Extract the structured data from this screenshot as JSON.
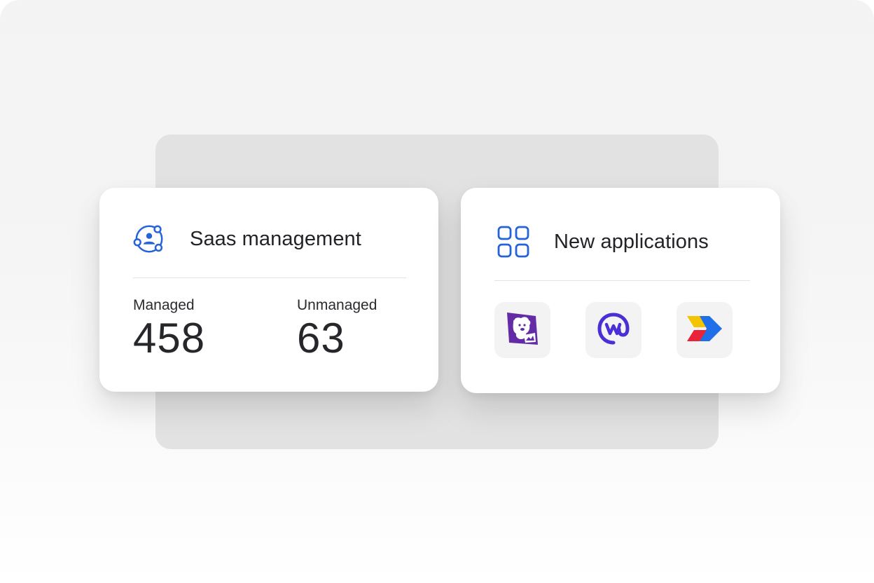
{
  "saas_card": {
    "title": "Saas management",
    "icon": "user-network-icon",
    "stats": [
      {
        "label": "Managed",
        "value": "458"
      },
      {
        "label": "Unmanaged",
        "value": "63"
      }
    ]
  },
  "apps_card": {
    "title": "New applications",
    "icon": "grid-icon",
    "apps": [
      {
        "icon": "datadog-logo-icon",
        "color": "#632CA6"
      },
      {
        "icon": "workplace-logo-icon",
        "color": "#4A2FD6"
      },
      {
        "icon": "chevron-logo-icon",
        "colors": [
          "#F5C400",
          "#1E6FE8",
          "#E8233A"
        ]
      }
    ]
  },
  "colors": {
    "accent_blue": "#2463D9",
    "card_bg": "#FFFFFF",
    "backdrop": "#E2E2E2"
  }
}
